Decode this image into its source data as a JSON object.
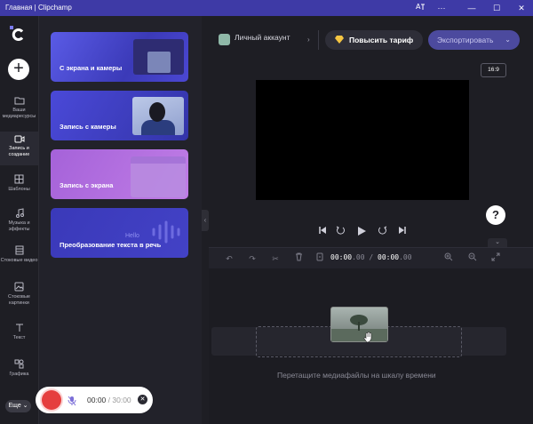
{
  "window": {
    "title": "Главная | Clipchamp"
  },
  "rail": {
    "items": [
      {
        "label": "Ваши медиаресурсы",
        "icon": "folder-icon"
      },
      {
        "label": "Запись и создание",
        "icon": "camera-icon",
        "active": true
      },
      {
        "label": "Шаблоны",
        "icon": "templates-icon"
      },
      {
        "label": "Музыка и эффекты",
        "icon": "music-icon"
      },
      {
        "label": "Стоковые видео",
        "icon": "film-icon"
      },
      {
        "label": "Стоковые картинки",
        "icon": "image-icon"
      },
      {
        "label": "Текст",
        "icon": "text-icon"
      },
      {
        "label": "Графика",
        "icon": "graphics-icon"
      }
    ],
    "more_label": "Еще"
  },
  "record_panel": {
    "cards": [
      {
        "label": "С экрана и камеры"
      },
      {
        "label": "Запись с камеры"
      },
      {
        "label": "Запись с экрана"
      },
      {
        "label": "Преобразование текста в речь",
        "hello": "Hello"
      }
    ]
  },
  "header": {
    "account_label": "Личный аккаунт",
    "upgrade_label": "Повысить тариф",
    "export_label": "Экспортировать"
  },
  "preview": {
    "aspect_ratio": "16:9"
  },
  "timeline": {
    "time_current": "00:00",
    "time_current_frac": ".00",
    "time_separator": " / ",
    "time_total": "00:00",
    "time_total_frac": ".00",
    "drop_hint": "Перетащите медиафайлы на шкалу времени"
  },
  "recorder": {
    "elapsed": "00:00",
    "separator": " / ",
    "limit": "30:00"
  },
  "help_label": "?",
  "colors": {
    "titlebar": "#3e3aa6",
    "background": "#1e1e24",
    "record": "#e53e3e",
    "export_button": "#4c4a9e"
  }
}
